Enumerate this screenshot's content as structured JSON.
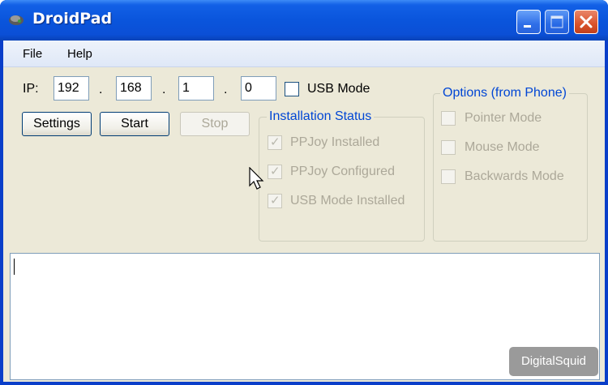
{
  "window": {
    "title": "DroidPad"
  },
  "menu": {
    "file": "File",
    "help": "Help"
  },
  "connection": {
    "ip_label": "IP:",
    "octets": [
      "192",
      "168",
      "1",
      "0"
    ],
    "separator": ".",
    "usb_mode_label": "USB Mode"
  },
  "buttons": {
    "settings": "Settings",
    "start": "Start",
    "stop": "Stop"
  },
  "installation": {
    "title": "Installation Status",
    "items": [
      "PPJoy Installed",
      "PPJoy Configured",
      "USB Mode Installed"
    ]
  },
  "options": {
    "title": "Options (from Phone)",
    "items": [
      "Pointer Mode",
      "Mouse Mode",
      "Backwards Mode"
    ]
  },
  "watermark": "DigitalSquid",
  "colors": {
    "title_bar": "#0a55dc",
    "group_title": "#0046d5",
    "close_button": "#d9532b"
  }
}
